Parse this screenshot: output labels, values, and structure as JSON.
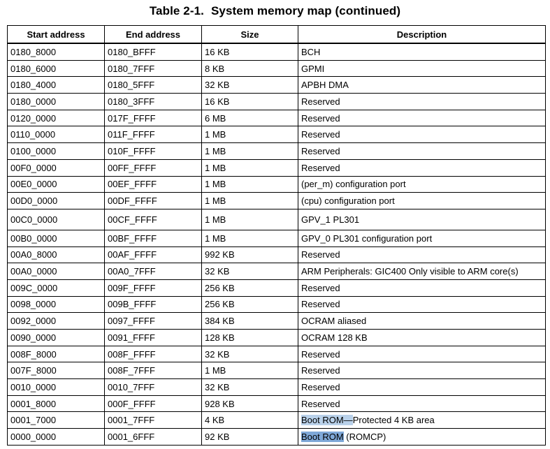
{
  "title": {
    "number": "Table 2-1.",
    "text": "System memory map (continued)"
  },
  "table": {
    "headers": [
      "Start address",
      "End address",
      "Size",
      "Description"
    ],
    "rows": [
      {
        "start": "0180_8000",
        "end": "0180_BFFF",
        "size": "16 KB",
        "desc": "BCH"
      },
      {
        "start": "0180_6000",
        "end": "0180_7FFF",
        "size": "8 KB",
        "desc": "GPMI"
      },
      {
        "start": "0180_4000",
        "end": "0180_5FFF",
        "size": "32 KB",
        "desc": "APBH DMA"
      },
      {
        "start": "0180_0000",
        "end": "0180_3FFF",
        "size": "16 KB",
        "desc": "Reserved"
      },
      {
        "start": "0120_0000",
        "end": "017F_FFFF",
        "size": "6 MB",
        "desc": "Reserved"
      },
      {
        "start": "0110_0000",
        "end": "011F_FFFF",
        "size": "1 MB",
        "desc": "Reserved"
      },
      {
        "start": "0100_0000",
        "end": "010F_FFFF",
        "size": "1 MB",
        "desc": "Reserved"
      },
      {
        "start": "00F0_0000",
        "end": "00FF_FFFF",
        "size": "1 MB",
        "desc": "Reserved"
      },
      {
        "start": "00E0_0000",
        "end": "00EF_FFFF",
        "size": "1 MB",
        "desc": "(per_m) configuration port"
      },
      {
        "start": "00D0_0000",
        "end": "00DF_FFFF",
        "size": "1 MB",
        "desc": "(cpu) configuration port"
      },
      {
        "start": "00C0_0000",
        "end": "00CF_FFFF",
        "size": "1 MB",
        "desc": "GPV_1 PL301"
      },
      {
        "start": "00B0_0000",
        "end": "00BF_FFFF",
        "size": "1 MB",
        "desc": "GPV_0 PL301 configuration port"
      },
      {
        "start": "00A0_8000",
        "end": "00AF_FFFF",
        "size": "992 KB",
        "desc": "Reserved"
      },
      {
        "start": "00A0_0000",
        "end": "00A0_7FFF",
        "size": "32 KB",
        "desc": "ARM Peripherals: GIC400 Only visible to ARM core(s)"
      },
      {
        "start": "009C_0000",
        "end": "009F_FFFF",
        "size": "256 KB",
        "desc": "Reserved"
      },
      {
        "start": "0098_0000",
        "end": "009B_FFFF",
        "size": "256 KB",
        "desc": "Reserved"
      },
      {
        "start": "0092_0000",
        "end": "0097_FFFF",
        "size": "384 KB",
        "desc": "OCRAM aliased"
      },
      {
        "start": "0090_0000",
        "end": "0091_FFFF",
        "size": "128 KB",
        "desc": "OCRAM 128 KB"
      },
      {
        "start": "008F_8000",
        "end": "008F_FFFF",
        "size": "32 KB",
        "desc": "Reserved"
      },
      {
        "start": "007F_8000",
        "end": "008F_7FFF",
        "size": "1 MB",
        "desc": "Reserved"
      },
      {
        "start": "0010_0000",
        "end": "0010_7FFF",
        "size": "32 KB",
        "desc": "Reserved"
      },
      {
        "start": "0001_8000",
        "end": "000F_FFFF",
        "size": "928 KB",
        "desc": "Reserved"
      },
      {
        "start": "0001_7000",
        "end": "0001_7FFF",
        "size": "4 KB",
        "desc_hl": "Boot ROM—",
        "desc_rest": "Protected 4 KB area"
      },
      {
        "start": "0000_0000",
        "end": "0001_6FFF",
        "size": "92 KB",
        "desc_hl": "Boot ROM",
        "desc_rest": " (ROMCP)"
      }
    ]
  },
  "colors": {
    "selection_light": "#b9d1ea",
    "selection_strong": "#7fa8d8"
  }
}
